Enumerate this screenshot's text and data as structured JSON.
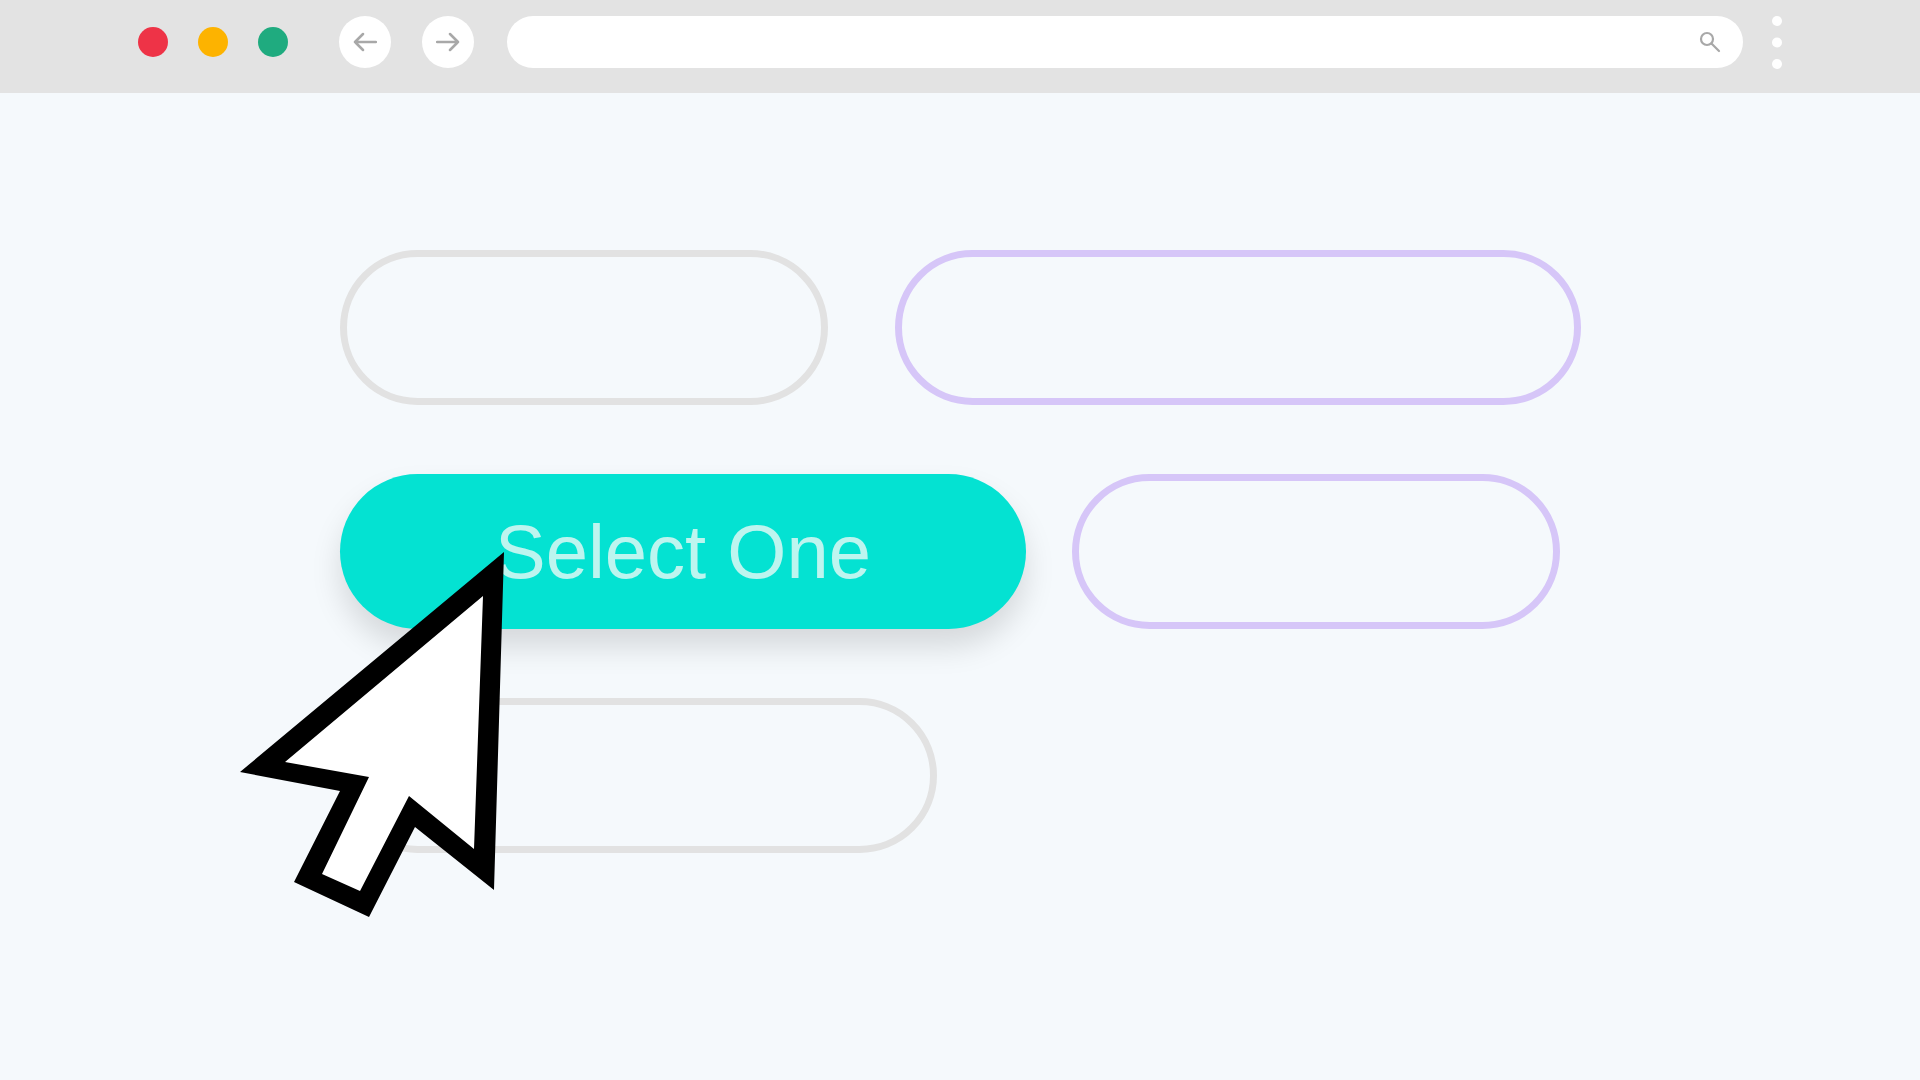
{
  "browser": {
    "window_controls": [
      {
        "color": "#ee3347"
      },
      {
        "color": "#fdb300"
      },
      {
        "color": "#1fab7f"
      }
    ]
  },
  "rows": [
    {
      "options": [
        {
          "selected": false,
          "color": "#e2e2e2"
        },
        {
          "selected": false,
          "color": "#d6c6f8"
        }
      ]
    },
    {
      "options": [
        {
          "selected": true,
          "color": "#04e2d2",
          "label": "Select One"
        },
        {
          "selected": false,
          "color": "#d6c6f8"
        }
      ]
    },
    {
      "options": [
        {
          "selected": false,
          "color": "#e2e2e2"
        }
      ]
    }
  ]
}
